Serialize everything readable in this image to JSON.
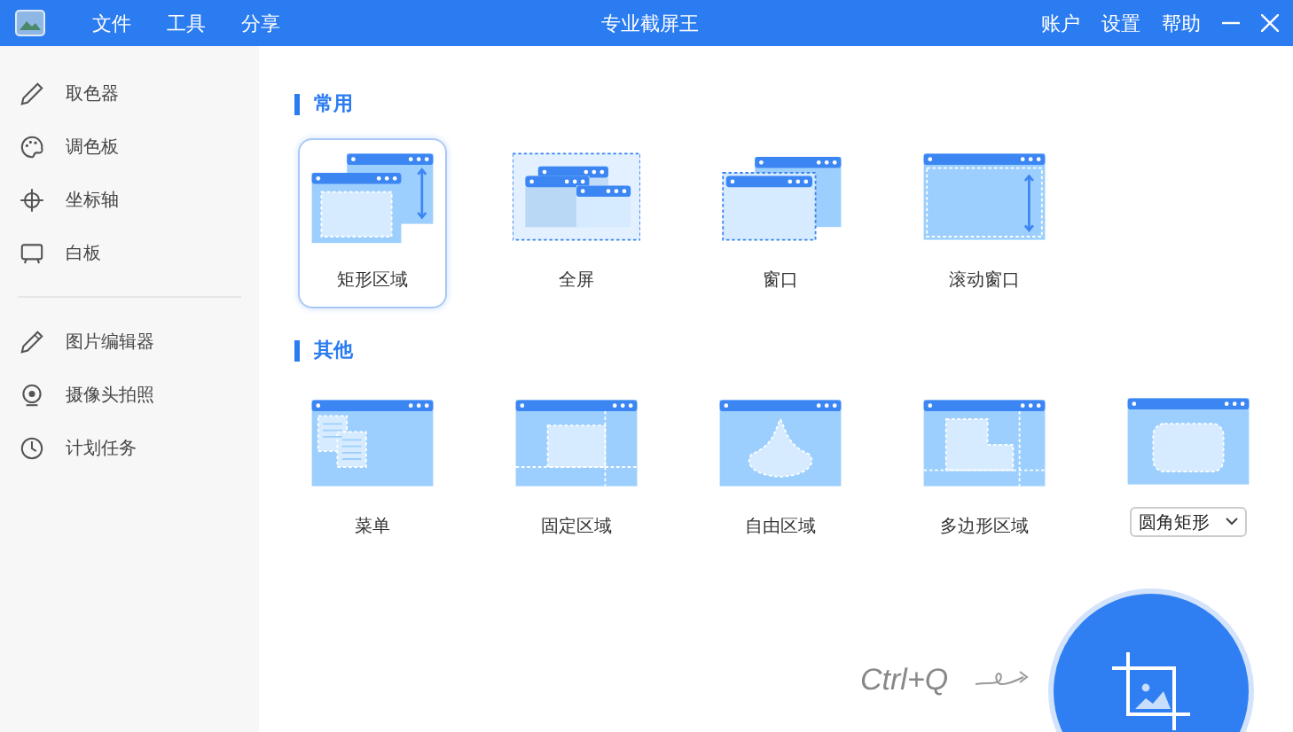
{
  "window": {
    "title": "专业截屏王"
  },
  "menu": [
    {
      "label": "文件"
    },
    {
      "label": "工具"
    },
    {
      "label": "分享"
    }
  ],
  "top_links": [
    {
      "label": "账户"
    },
    {
      "label": "设置"
    },
    {
      "label": "帮助"
    }
  ],
  "sidebar": {
    "groups": [
      [
        {
          "label": "取色器"
        },
        {
          "label": "调色板"
        },
        {
          "label": "坐标轴"
        },
        {
          "label": "白板"
        }
      ],
      [
        {
          "label": "图片编辑器"
        },
        {
          "label": "摄像头拍照"
        },
        {
          "label": "计划任务"
        }
      ]
    ]
  },
  "sections": [
    {
      "title": "常用",
      "tiles": [
        {
          "kind": "rect",
          "label": "矩形区域",
          "selected": true
        },
        {
          "kind": "full",
          "label": "全屏",
          "selected": false
        },
        {
          "kind": "window",
          "label": "窗口",
          "selected": false
        },
        {
          "kind": "scroll",
          "label": "滚动窗口",
          "selected": false
        }
      ]
    },
    {
      "title": "其他",
      "tiles": [
        {
          "kind": "menu",
          "label": "菜单",
          "selected": false
        },
        {
          "kind": "fixed",
          "label": "固定区域",
          "selected": false
        },
        {
          "kind": "free",
          "label": "自由区域",
          "selected": false
        },
        {
          "kind": "polygon",
          "label": "多边形区域",
          "selected": false
        },
        {
          "kind": "round",
          "dropdown": "圆角矩形"
        }
      ]
    }
  ],
  "capture": {
    "shortcut": "Ctrl+Q"
  }
}
